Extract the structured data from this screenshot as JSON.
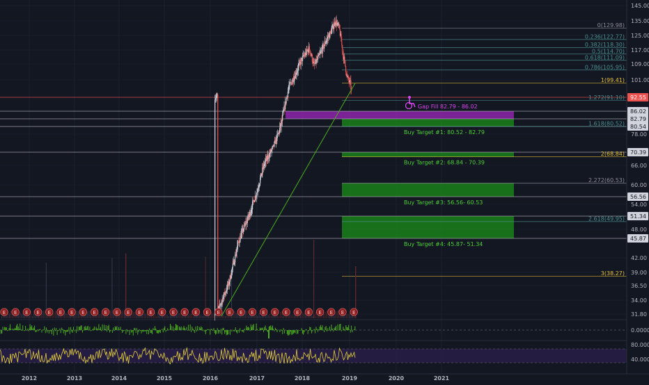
{
  "colors": {
    "background": "#131722",
    "candle_up": "#d1d4dc",
    "candle_down": "#ef5350",
    "trendline": "#3cb043",
    "level_line": "#b2b5be",
    "current_price": "#ef5350",
    "gap_zone": "#8e24aa",
    "target_zone": "#1b7a1b",
    "target_label": "#4cd137",
    "fib_gold": "#e6c13c",
    "fib_gray": "#8a8d96",
    "fib_teal": "#4a8f8f",
    "osc_green": "#4caf1f",
    "rsi_yellow": "#e6d23c",
    "rsi_band": "#2a1f4a",
    "earnings_badge": "#8b1e1e"
  },
  "chart_data": {
    "type": "candlestick",
    "price_axis": {
      "min": 30,
      "max": 146,
      "ticks": [
        "145.00",
        "135.00",
        "125.00",
        "117.00",
        "109.00",
        "101.00",
        "78.00",
        "66.00",
        "60.00",
        "54.00",
        "48.00",
        "42.00",
        "39.00",
        "36.50",
        "34.00",
        "31.80"
      ]
    },
    "time_axis": {
      "ticks": [
        "2012",
        "2013",
        "2014",
        "2015",
        "2016",
        "2017",
        "2018",
        "2019",
        "2020",
        "2021"
      ]
    },
    "highlighted_levels": [
      {
        "value": 92.55,
        "label": "92.55",
        "color": "#ef5350"
      },
      {
        "value": 86.02,
        "label": "86.02"
      },
      {
        "value": 82.79,
        "label": "82.79"
      },
      {
        "value": 80.54,
        "label": "80.54"
      },
      {
        "value": 70.39,
        "label": "70.39"
      },
      {
        "value": 56.56,
        "label": "56.56"
      },
      {
        "value": 51.34,
        "label": "51.34"
      },
      {
        "value": 45.87,
        "label": "45.87"
      }
    ],
    "fib_levels": [
      {
        "label": "0(129.98)",
        "value": 129.98,
        "color": "#8a8d96"
      },
      {
        "label": "0.236(122.77)",
        "value": 122.77,
        "color": "#4a8f8f"
      },
      {
        "label": "0.382(118.30)",
        "value": 118.3,
        "color": "#4a8f8f"
      },
      {
        "label": "0.5(114.70)",
        "value": 114.7,
        "color": "#4a8f8f"
      },
      {
        "label": "0.618(111.09)",
        "value": 111.09,
        "color": "#4a8f8f"
      },
      {
        "label": "0.786(105.95)",
        "value": 105.95,
        "color": "#4a8f8f"
      },
      {
        "label": "1(99.41)",
        "value": 99.41,
        "color": "#e6c13c"
      },
      {
        "label": "1.272(91.10)",
        "value": 91.1,
        "color": "#4a8f8f"
      },
      {
        "label": "1.618(80.52)",
        "value": 80.52,
        "color": "#4a8f8f"
      },
      {
        "label": "2(68.84)",
        "value": 68.84,
        "color": "#e6c13c"
      },
      {
        "label": "2.272(60.53)",
        "value": 60.53,
        "color": "#8a8d96"
      },
      {
        "label": "2.618(49.95)",
        "value": 49.95,
        "color": "#4a8f8f"
      },
      {
        "label": "3(38.27)",
        "value": 38.27,
        "color": "#e6c13c"
      }
    ],
    "zones": [
      {
        "kind": "gap",
        "label": "Gap Fill 82.79 - 86.02",
        "low": 82.79,
        "high": 86.02
      },
      {
        "kind": "target",
        "label": "Buy Target #1: 80.52 - 82.79",
        "low": 80.52,
        "high": 82.79
      },
      {
        "kind": "target",
        "label": "Buy Target #2: 68.84 - 70.39",
        "low": 68.84,
        "high": 70.39
      },
      {
        "kind": "target",
        "label": "Buy Target #3: 56.56- 60.53",
        "low": 56.56,
        "high": 60.53
      },
      {
        "kind": "target",
        "label": "Buy Target #4: 45.87- 51.34",
        "low": 45.87,
        "high": 51.34
      }
    ],
    "trendline": {
      "from": [
        "2016-01",
        30.5
      ],
      "to": [
        "2019-01",
        99.41
      ]
    },
    "oscillator_ticks": [
      "0.0000"
    ],
    "rsi_ticks": [
      "80.0000",
      "40.0000"
    ],
    "earnings_marker": "E"
  }
}
